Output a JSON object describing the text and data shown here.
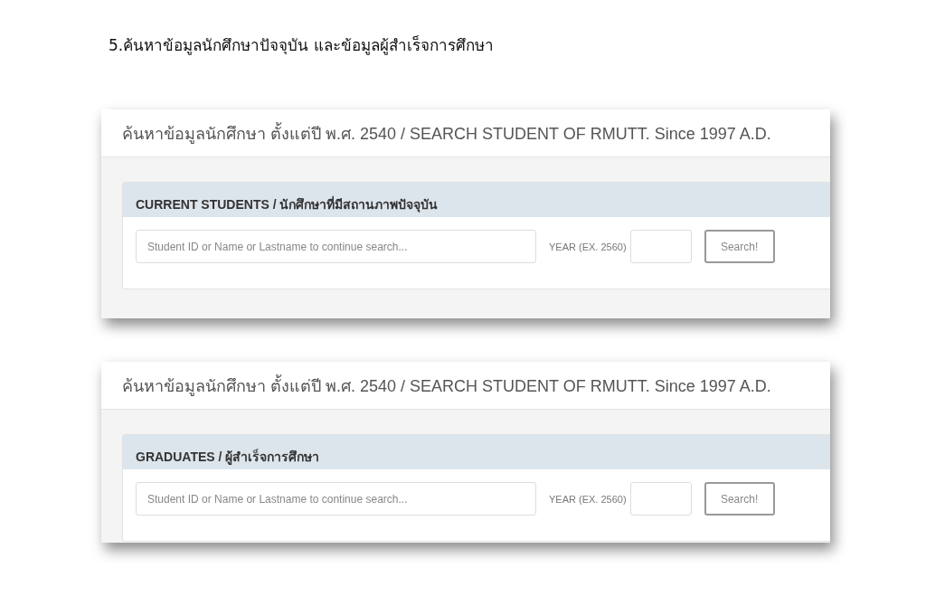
{
  "heading": "5.ค้นหาข้อมูลนักศึกษาปัจจุบัน และข้อมูลผู้สำเร็จการศึกษา",
  "panels": [
    {
      "title": "ค้นหาข้อมูลนักศึกษา ตั้งแต่ปี พ.ศ. 2540 / SEARCH STUDENT OF RMUTT. Since 1997 A.D.",
      "section_title": "CURRENT STUDENTS / นักศึกษาที่มีสถานภาพปัจจุบัน",
      "search_field": {
        "placeholder": "Student ID or Name or Lastname to continue search..."
      },
      "year_label": "YEAR (EX. 2560)",
      "search_button": "Search!"
    },
    {
      "title": "ค้นหาข้อมูลนักศึกษา ตั้งแต่ปี พ.ศ. 2540 / SEARCH STUDENT OF RMUTT. Since 1997 A.D.",
      "section_title": "GRADUATES / ผู้สำเร็จการศึกษา",
      "search_field": {
        "placeholder": "Student ID or Name or Lastname to continue search..."
      },
      "year_label": "YEAR (EX. 2560)",
      "search_button": "Search!"
    }
  ]
}
